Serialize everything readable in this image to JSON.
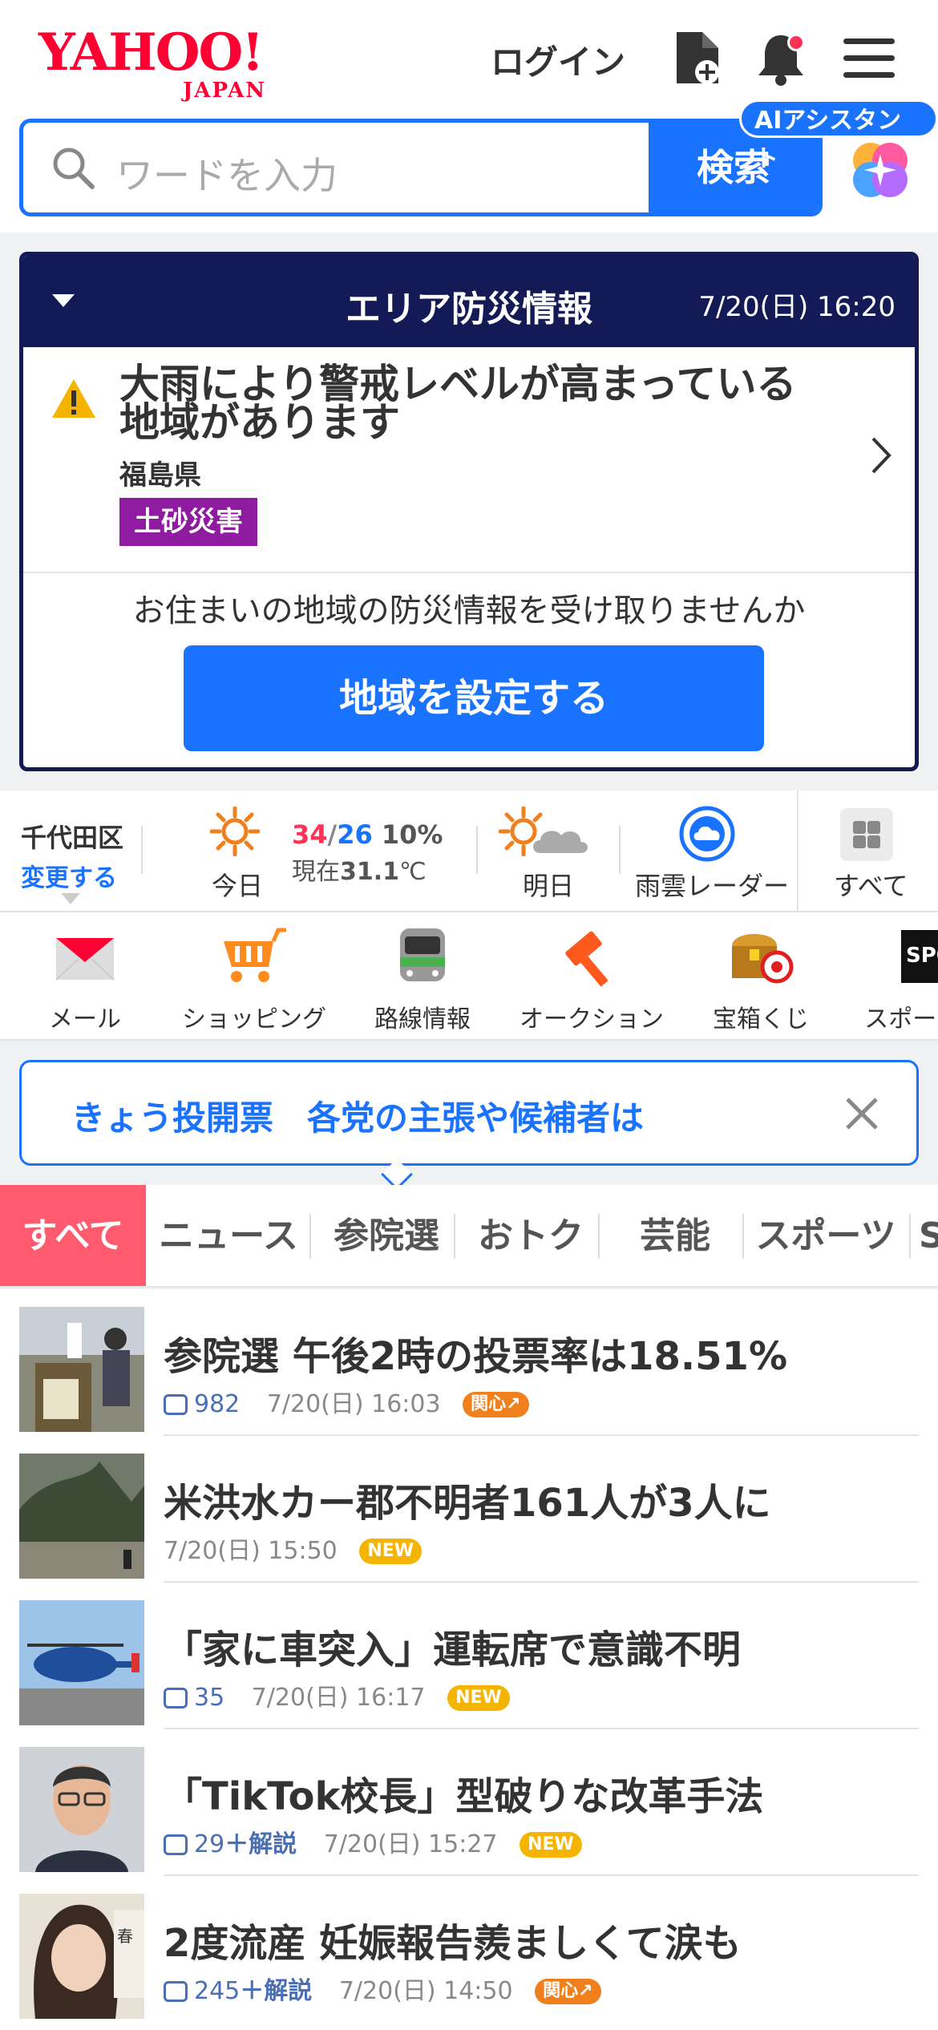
{
  "header": {
    "logo_text": "YAHOO!",
    "logo_sub": "JAPAN",
    "login_label": "ログイン",
    "search_placeholder": "ワードを入力",
    "search_button": "検索",
    "ai_badge": "AIアシスタント"
  },
  "disaster": {
    "title": "エリア防災情報",
    "datetime": "7/20(日) 16:20",
    "message": "大雨により警戒レベルが高まっている地域があります",
    "prefecture": "福島県",
    "tag": "土砂災害",
    "tag_color": "#8e1ba0",
    "prompt": "お住まいの地域の防災情報を受け取りませんか",
    "button_label": "地域を設定する"
  },
  "weather": {
    "location": "千代田区",
    "change_label": "変更する",
    "today_label": "今日",
    "high": "34",
    "low": "26",
    "precip": "10%",
    "now_label": "現在",
    "now_temp": "31.1",
    "now_unit": "℃",
    "tomorrow_label": "明日",
    "radar_label": "雨雲レーダー",
    "all_label": "すべて"
  },
  "services": [
    {
      "label": "メール",
      "icon": "mail-icon"
    },
    {
      "label": "ショッピング",
      "icon": "cart-icon"
    },
    {
      "label": "路線情報",
      "icon": "train-icon"
    },
    {
      "label": "オークション",
      "icon": "gavel-icon"
    },
    {
      "label": "宝箱くじ",
      "icon": "treasure-icon"
    },
    {
      "label": "スポーツ",
      "icon": "sports-icon"
    }
  ],
  "banner": {
    "text": "きょう投開票　各党の主張や候補者は"
  },
  "tabs": [
    "すべて",
    "ニュース",
    "参院選",
    "おトク",
    "芸能",
    "スポーツ",
    "S"
  ],
  "news": [
    {
      "title": "参院選 午後2時の投票率は18.51%",
      "comments": "982",
      "explain": "",
      "time": "7/20(日) 16:03",
      "badge": "関心↗",
      "badge_type": "hot"
    },
    {
      "title": "米洪水カー郡不明者161人が3人に",
      "comments": "",
      "explain": "",
      "time": "7/20(日) 15:50",
      "badge": "NEW",
      "badge_type": "new"
    },
    {
      "title": "「家に車突入」運転席で意識不明",
      "comments": "35",
      "explain": "",
      "time": "7/20(日) 16:17",
      "badge": "NEW",
      "badge_type": "new"
    },
    {
      "title": "「TikTok校長」型破りな改革手法",
      "comments": "29",
      "explain": "＋解説",
      "time": "7/20(日) 15:27",
      "badge": "NEW",
      "badge_type": "new"
    },
    {
      "title": "2度流産 妊娠報告羨ましくて涙も",
      "comments": "245",
      "explain": "＋解説",
      "time": "7/20(日) 14:50",
      "badge": "関心↗",
      "badge_type": "hot"
    }
  ],
  "colors": {
    "brand_red": "#ff0033",
    "accent_blue": "#1a73ff",
    "disaster_navy": "#141a55",
    "tab_active": "#ff5a6e"
  }
}
